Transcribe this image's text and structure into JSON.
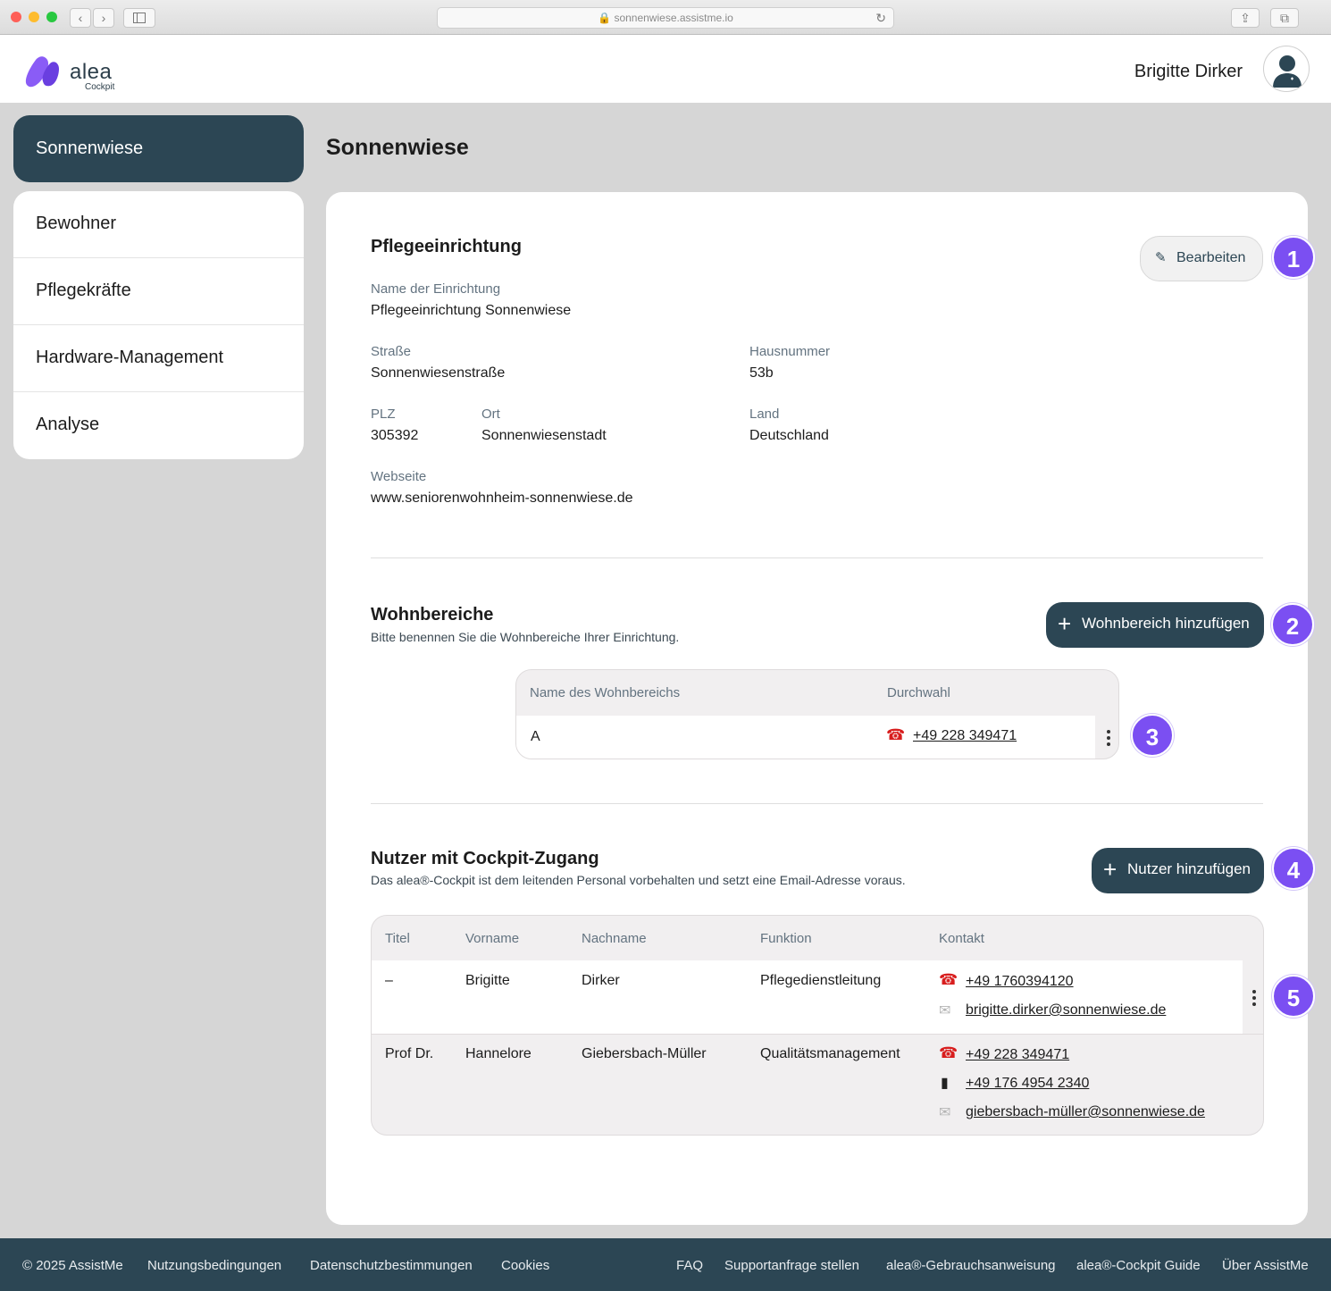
{
  "browser": {
    "url": "sonnenwiese.assistme.io",
    "traffic_colors": [
      "#fe5f57",
      "#febc2e",
      "#28c840"
    ]
  },
  "header": {
    "logo_word": "alea",
    "logo_sub": "Cockpit",
    "user_name": "Brigitte Dirker",
    "avatar_icon": "user-avatar-icon"
  },
  "sidebar": {
    "active": "Sonnenwiese",
    "items": [
      {
        "label": "Bewohner"
      },
      {
        "label": "Pflegekräfte"
      },
      {
        "label": "Hardware-Management"
      },
      {
        "label": "Analyse"
      }
    ]
  },
  "page_title": "Sonnenwiese",
  "facility": {
    "title": "Pflegeeinrichtung",
    "edit_label": "Bearbeiten",
    "name_label": "Name der Einrichtung",
    "name_value": "Pflegeeinrichtung Sonnenwiese",
    "street_label": "Straße",
    "street_value": "Sonnenwiesenstraße",
    "number_label": "Hausnummer",
    "number_value": "53b",
    "zip_label": "PLZ",
    "zip_value": "305392",
    "city_label": "Ort",
    "city_value": "Sonnenwiesenstadt",
    "country_label": "Land",
    "country_value": "Deutschland",
    "web_label": "Webseite",
    "web_value": "www.seniorenwohnheim-sonnenwiese.de"
  },
  "areas": {
    "title": "Wohnbereiche",
    "subtitle": "Bitte benennen Sie die Wohnbereiche Ihrer Einrichtung.",
    "add_label": "Wohnbereich hinzufügen",
    "col_name": "Name des Wohnbereichs",
    "col_phone": "Durchwahl",
    "rows": [
      {
        "name": "A",
        "phone": "+49 228 349471"
      }
    ]
  },
  "users": {
    "title": "Nutzer mit Cockpit-Zugang",
    "subtitle": "Das alea®-Cockpit ist dem leitenden Personal vorbehalten und setzt eine Email-Adresse voraus.",
    "add_label": "Nutzer hinzufügen",
    "col_title": "Titel",
    "col_first": "Vorname",
    "col_last": "Nachname",
    "col_role": "Funktion",
    "col_contact": "Kontakt",
    "rows": [
      {
        "title": "–",
        "first": "Brigitte",
        "last": "Dirker",
        "role": "Pflegedienstleitung",
        "phone": "+49 1760394120",
        "email": "brigitte.dirker@sonnenwiese.de"
      },
      {
        "title": "Prof Dr.",
        "first": "Hannelore",
        "last": "Giebersbach-Müller",
        "role": "Qualitätsmanagement",
        "phone": "+49 228 349471",
        "mobile": "+49 176 4954 2340",
        "email": "giebersbach-müller@sonnenwiese.de"
      }
    ]
  },
  "badges": [
    "1",
    "2",
    "3",
    "4",
    "5"
  ],
  "footer": {
    "copyright": "© 2025 AssistMe",
    "terms": "Nutzungsbedingungen",
    "privacy": "Datenschutzbestimmungen",
    "cookies": "Cookies",
    "faq": "FAQ",
    "support": "Supportanfrage stellen",
    "manual": "alea®-Gebrauchsanweisung",
    "guide": "alea®-Cockpit Guide",
    "about": "Über AssistMe"
  },
  "colors": {
    "brand_dark": "#2c4654",
    "badge_purple": "#7b4ff2",
    "phone_red": "#d81e1e",
    "logo_purple": "#8a5cf6"
  }
}
